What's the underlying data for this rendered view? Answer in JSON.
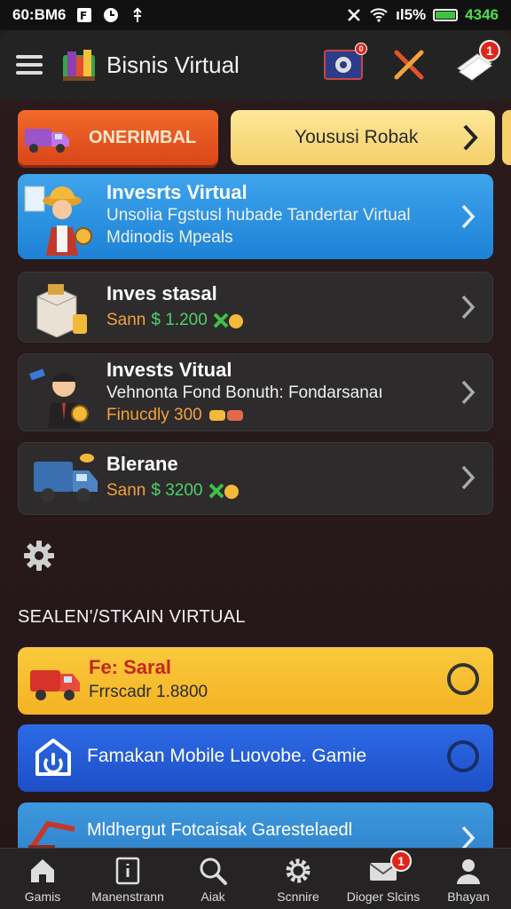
{
  "status_bar": {
    "time": "60:BM6",
    "battery_percent": "ıl5%",
    "right_time": "4346"
  },
  "header": {
    "title": "Bisnis Virtual",
    "notification_count": "1"
  },
  "tabs": {
    "left_label": "ONERIMBAL",
    "right_label": "Yoususi Robak"
  },
  "cards": [
    {
      "title": "Invesrts Virtual",
      "line1": "Unsolia Fgstusl hubade Tandertar Virtual",
      "line2": "Mdinodis Mpeals"
    },
    {
      "title": "Inves stasal",
      "price_prefix": "Sann",
      "price_value": "$ 1.200"
    },
    {
      "title": "Invests Vitual",
      "line1": "Vehnonta Fond Bonuth: Fondarsanaı",
      "price_prefix": "Finucdly 300"
    },
    {
      "title": "Blerane",
      "price_prefix": "Sann",
      "price_value": "$ 3200"
    }
  ],
  "section_title": "SEALEN'/STKAIN VIRTUAL",
  "options": [
    {
      "title": "Fe: Saral",
      "subtitle": "Frrscadr 1.8800"
    },
    {
      "title": "Famakan Mobile Luovobe. Gamie"
    },
    {
      "title": "Mldhergut Fotcaisak Garestelaedl"
    }
  ],
  "nav": {
    "items": [
      {
        "label": "Gamis",
        "icon": "home-icon"
      },
      {
        "label": "Manenstrann",
        "icon": "document-icon"
      },
      {
        "label": "Aiak",
        "icon": "search-icon"
      },
      {
        "label": "Scnnire",
        "icon": "gear-icon"
      },
      {
        "label": "Dioger Slcins",
        "icon": "mail-icon",
        "badge": "1"
      },
      {
        "label": "Bhayan",
        "icon": "user-icon"
      }
    ]
  },
  "colors": {
    "background": "#2a1a1c",
    "orange_tab": "#e35a22",
    "yellow_tab": "#f9dc80",
    "blue_card": "#2a93e2",
    "badge_red": "#e0251b"
  }
}
